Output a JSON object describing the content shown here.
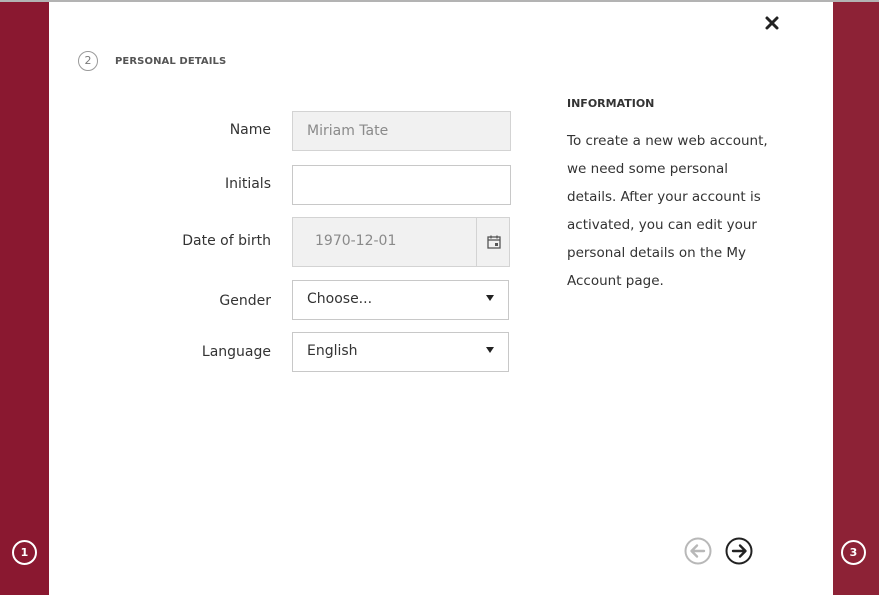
{
  "wizard": {
    "step_number": "2",
    "step_title": "PERSONAL DETAILS",
    "prev_step_number": "1",
    "next_step_number": "3"
  },
  "form": {
    "name_label": "Name",
    "name_value": "Miriam Tate",
    "initials_label": "Initials",
    "initials_value": "",
    "dob_label": "Date of birth",
    "dob_value": "1970-12-01",
    "gender_label": "Gender",
    "gender_value": "Choose...",
    "language_label": "Language",
    "language_value": "English"
  },
  "info": {
    "title": "INFORMATION",
    "text": "To create a new web account, we need some personal details. After your account is activated, you can edit your personal details on the My Account page."
  },
  "colors": {
    "rail": "#8a1830",
    "field_readonly_bg": "#f1f1f1"
  },
  "icons": {
    "close": "close-icon",
    "calendar": "calendar-icon",
    "back": "arrow-left-circle-icon",
    "forward": "arrow-right-circle-icon"
  }
}
